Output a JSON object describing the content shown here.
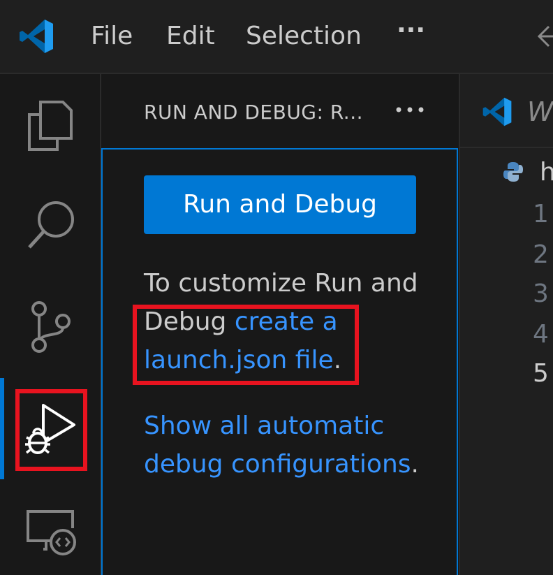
{
  "titlebar": {
    "menu": [
      "File",
      "Edit",
      "Selection"
    ],
    "more": "···"
  },
  "activitybar": {
    "items": [
      "explorer-icon",
      "search-icon",
      "source-control-icon",
      "run-and-debug-icon",
      "remote-explorer-icon"
    ],
    "active": "run-and-debug-icon",
    "accent": "#0078d4",
    "highlight_color": "#e8131f"
  },
  "sidebar": {
    "title": "RUN AND DEBUG: R...",
    "more": "···",
    "run_button_label": "Run and Debug",
    "customize_text": "To customize Run and Debug ",
    "create_link": "create a launch.json file",
    "period1": ".",
    "show_link": "Show all automatic debug configurations",
    "period2": "."
  },
  "editor": {
    "tab_label": "W",
    "breadcrumb": "h",
    "line_numbers": [
      "1",
      "2",
      "3",
      "4",
      "5"
    ],
    "current_line": "5"
  }
}
